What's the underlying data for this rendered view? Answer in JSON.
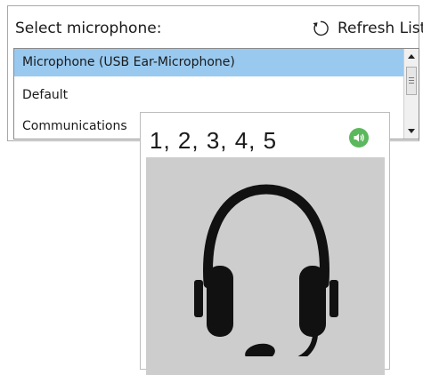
{
  "panel": {
    "title": "Select microphone:",
    "refresh_label": "Refresh List"
  },
  "microphones": [
    {
      "label": "Microphone (USB Ear-Microphone)",
      "selected": true
    },
    {
      "label": "Default",
      "selected": false
    },
    {
      "label": "Communications",
      "selected": false
    }
  ],
  "popup": {
    "text": "1, 2, 3, 4, 5",
    "speaker_icon": "speaker-icon",
    "image_icon": "headset-icon"
  },
  "colors": {
    "selection": "#99c9ef",
    "speaker_green": "#5cb85c",
    "image_background": "#cdcdcd"
  }
}
